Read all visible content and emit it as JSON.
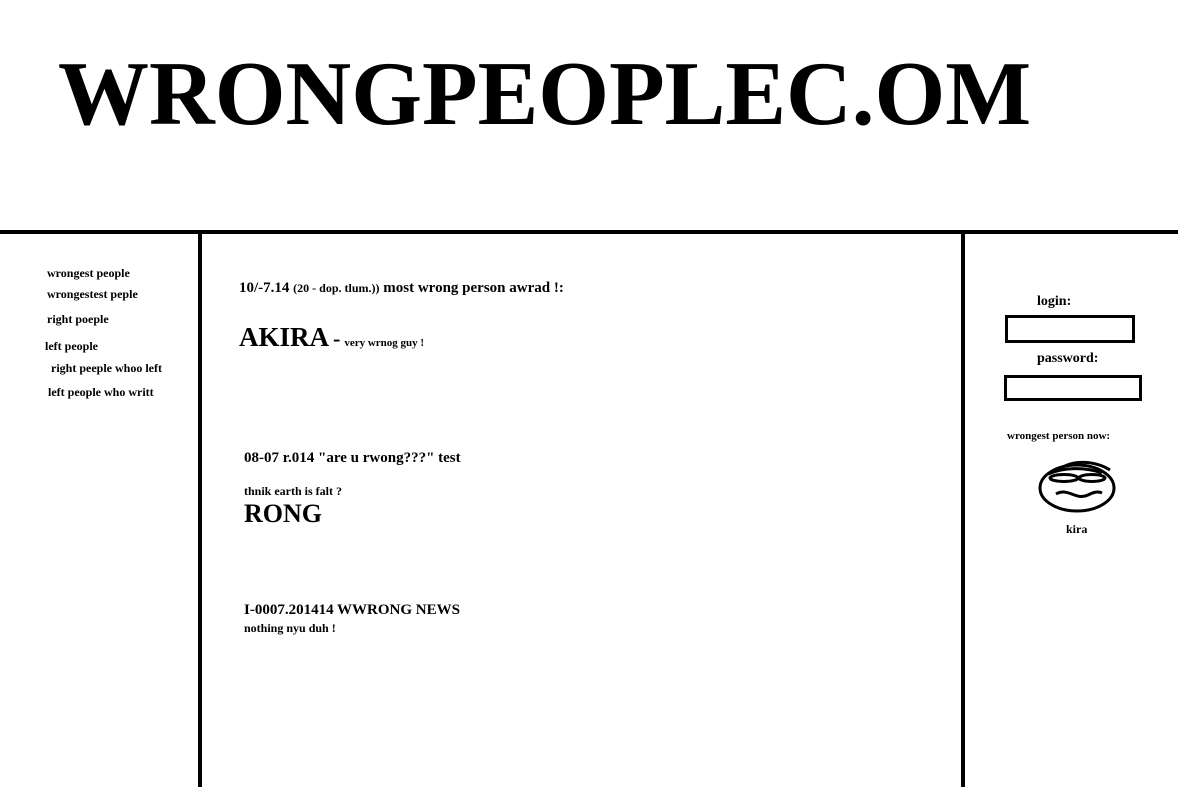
{
  "header": {
    "title": "WRONGPEOPLEC.OM"
  },
  "nav": [
    "wrongest people",
    "wrongestest peple",
    "right poeple",
    "left people",
    "right peeple whoo left",
    "left people who writt"
  ],
  "news": [
    {
      "date": "10/-7.14",
      "note": "(20 - dop. tlum.))",
      "headline": "most wrong person awrad !:",
      "winner": "AKIRA",
      "dash": "-",
      "winner_desc": "very wrnog guy !"
    },
    {
      "title": "08-07 r.014 \"are u rwong???\" test",
      "question": "thnik earth is falt ?",
      "answer": "RONG"
    },
    {
      "title": "I-0007.201414 WWRONG NEWS",
      "body": "nothing nyu duh !"
    }
  ],
  "login": {
    "login_label": "login:",
    "password_label": "password:",
    "login_value": "",
    "password_value": ""
  },
  "sidebar": {
    "wrongest_now_label": "wrongest person now:",
    "person_name": "kira"
  }
}
